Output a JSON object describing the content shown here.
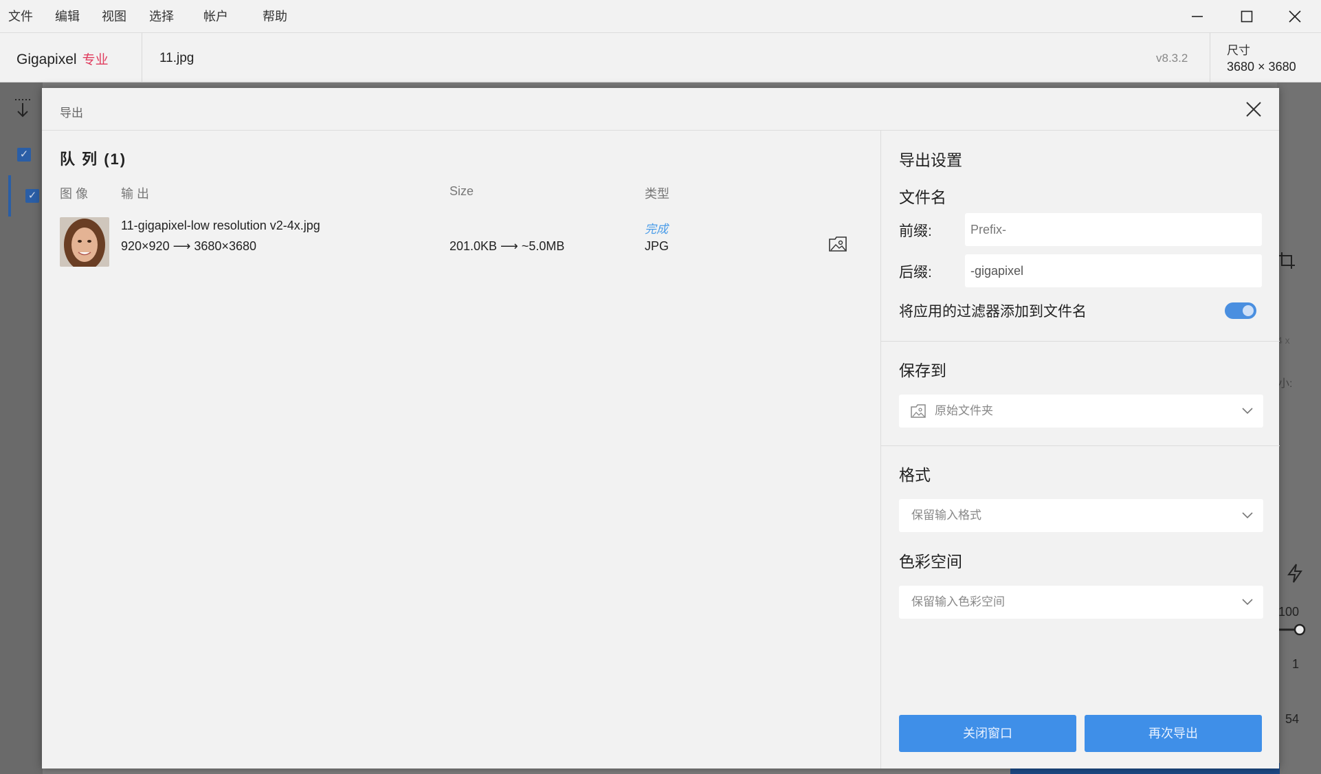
{
  "menu": [
    "文件",
    "编辑",
    "视图",
    "选择",
    "帐户",
    "帮助"
  ],
  "header": {
    "brand": "Gigapixel",
    "brand_tier": "专业",
    "filename": "11.jpg",
    "version": "v8.3.2",
    "dimensions_label": "尺寸",
    "dimensions_value": "3680 × 3680"
  },
  "background_panel": {
    "scale_text": "4 x",
    "size_text": "小:",
    "slider_max": "100",
    "value1": "1",
    "value2": "54"
  },
  "export_dialog": {
    "title": "导出",
    "queue": {
      "title": "队 列  (1)",
      "columns": [
        "图 像",
        "输 出",
        "Size",
        "类型"
      ],
      "items": [
        {
          "output_name": "11-gigapixel-low resolution v2-4x.jpg",
          "dimensions": "920×920 ⟶ 3680×3680",
          "size": "201.0KB ⟶ ~5.0MB",
          "status": "完成",
          "type": "JPG"
        }
      ]
    },
    "settings": {
      "title": "导出设置",
      "filename_section": "文件名",
      "prefix_label": "前缀:",
      "prefix_placeholder": "Prefix-",
      "suffix_label": "后缀:",
      "suffix_value": "-gigapixel",
      "append_filters_label": "将应用的过滤器添加到文件名",
      "append_filters_on": true,
      "save_to_section": "保存到",
      "save_to_value": "原始文件夹",
      "format_section": "格式",
      "format_value": "保留输入格式",
      "colorspace_section": "色彩空间",
      "colorspace_value": "保留输入色彩空间"
    },
    "buttons": {
      "close": "关闭窗口",
      "export_again": "再次导出"
    }
  },
  "colors": {
    "accent": "#3f8fe8",
    "brand_pro": "#e03a5c",
    "status_done": "#4a9ce8",
    "toggle_on": "#4a8fe0"
  }
}
